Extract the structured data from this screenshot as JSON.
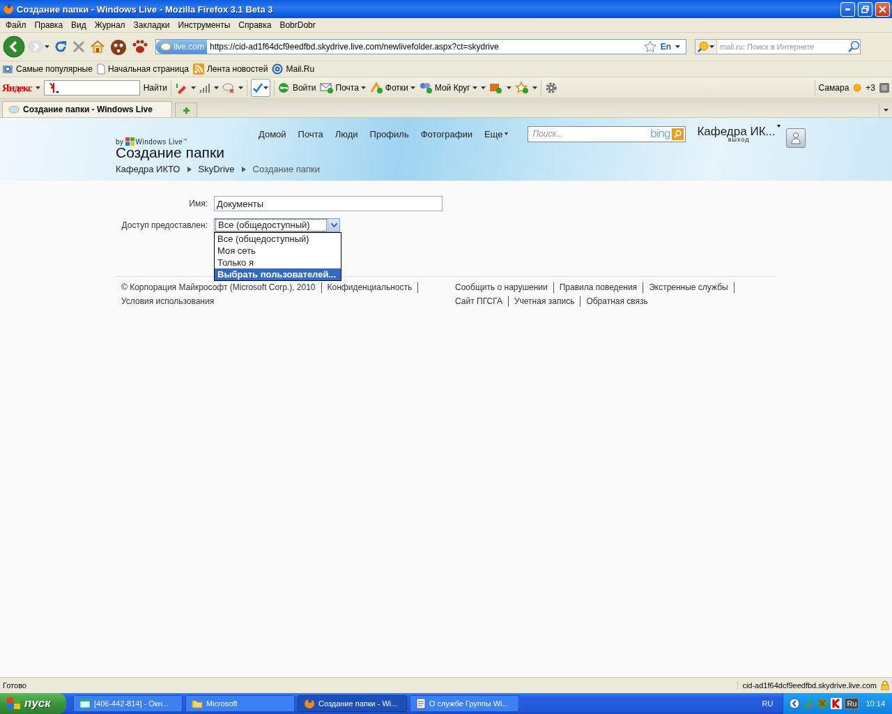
{
  "window": {
    "title": "Создание папки - Windows Live - Mozilla Firefox 3.1 Beta 3"
  },
  "menu": [
    "Файл",
    "Правка",
    "Вид",
    "Журнал",
    "Закладки",
    "Инструменты",
    "Справка",
    "BobrDobr"
  ],
  "nav": {
    "site_badge": "live.com",
    "url": "https://cid-ad1f64dcf9eedfbd.skydrive.live.com/newlivefolder.aspx?ct=skydrive",
    "lang": "En",
    "search_placeholder": "mail.ru: Поиск в Интернете"
  },
  "bookmarks": [
    "Самые популярные",
    "Начальная страница",
    "Лента новостей",
    "Mail.Ru"
  ],
  "yandex_bar": {
    "logo": "Яндекс",
    "find": "Найти",
    "items": [
      "Войти",
      "Почта",
      "Фотки",
      "Мой Круг"
    ],
    "city": "Самара",
    "temperature": "+3"
  },
  "tabs": [
    {
      "label": "Создание папки - Windows Live",
      "selected": true
    }
  ],
  "page": {
    "brand_by": "by",
    "brand": "Windows Live$^{™}$",
    "heading": "Создание папки",
    "nav": [
      "Домой",
      "Почта",
      "Люди",
      "Профиль",
      "Фотографии",
      "Еще"
    ],
    "search_placeholder": "Поиск...",
    "search_brand": "bing",
    "user": "Кафедра ИК...",
    "signout": "выход",
    "breadcrumbs": [
      "Кафедра ИКТО",
      "SkyDrive",
      "Создание папки"
    ],
    "form": {
      "name_label": "Имя:",
      "name_value": "Документы",
      "access_label": "Доступ предоставлен:",
      "access_value": "Все (общедоступный)",
      "dropdown_open": true,
      "options": [
        {
          "label": "Все (общедоступный)",
          "selected": false
        },
        {
          "label": "Моя сеть",
          "selected": false
        },
        {
          "label": "Только я",
          "selected": false
        },
        {
          "label": "Выбрать пользователей...",
          "selected": true
        }
      ]
    },
    "footer": {
      "left": [
        "© Корпорация Майкрософт (Microsoft Corp.), 2010",
        "Конфиденциальность",
        "Условия использования"
      ],
      "right": [
        "Сообщить о нарушении",
        "Правила поведения",
        "Экстренные службы",
        "Сайт ПГСГА",
        "Учетная запись",
        "Обратная связь"
      ]
    }
  },
  "status_bar": {
    "text": "Готово",
    "url": "cid-ad1f64dcf9eedfbd.skydrive.live.com"
  },
  "taskbar": {
    "start": "пуск",
    "tasks": [
      {
        "label": "[406-442-814] - Окн...",
        "selected": false
      },
      {
        "label": "Microsoft",
        "selected": false
      },
      {
        "label": "Создание папки - Wi...",
        "selected": true
      },
      {
        "label": "О службе Группы Wi...",
        "selected": false
      }
    ],
    "language": "RU",
    "tray_lang": "Ru",
    "clock": "10:14"
  }
}
